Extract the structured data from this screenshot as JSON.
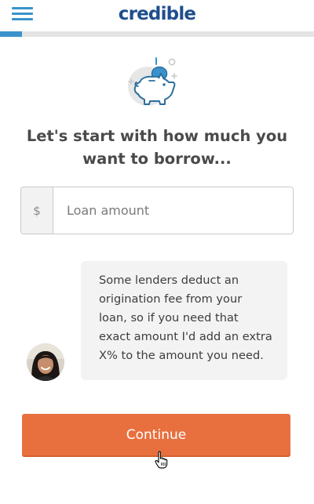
{
  "header": {
    "menu_icon": "hamburger-menu-icon",
    "logo_text": "credible",
    "brand_color": "#1f4e8c",
    "accent_color": "#3a92cd"
  },
  "progress": {
    "fraction": 0.07
  },
  "illustration": {
    "icon": "piggy-bank-icon"
  },
  "headline": "Let's start with how much you want to borrow...",
  "loan_input": {
    "prefix": "$",
    "placeholder": "Loan amount",
    "value": ""
  },
  "tip": {
    "text": "Some lenders deduct an origination fee from your loan, so if you need that exact amount I'd add an extra X% to the amount you need.",
    "avatar": "advisor-avatar"
  },
  "continue_button": {
    "label": "Continue",
    "color": "#e8703f"
  }
}
